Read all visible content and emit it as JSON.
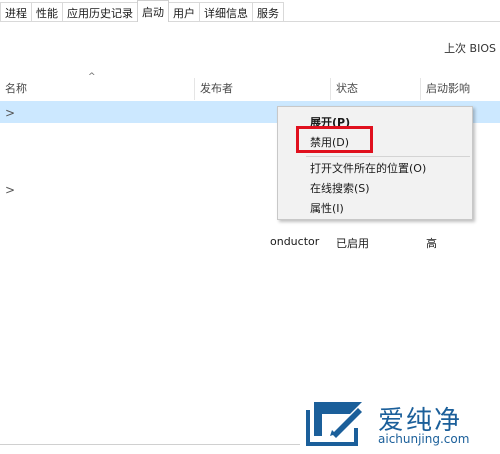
{
  "tabs": [
    {
      "label": "进程"
    },
    {
      "label": "性能"
    },
    {
      "label": "应用历史记录"
    },
    {
      "label": "启动",
      "active": true
    },
    {
      "label": "用户"
    },
    {
      "label": "详细信息"
    },
    {
      "label": "服务"
    }
  ],
  "bios_label": "上次 BIOS",
  "columns": {
    "name": "名称",
    "publisher": "发布者",
    "status": "状态",
    "impact": "启动影响"
  },
  "rows": [
    {
      "publisher_partial": "onductor",
      "status": "已启用",
      "impact": "高"
    }
  ],
  "context_menu": {
    "expand": "展开(P)",
    "disable": "禁用(D)",
    "open_location": "打开文件所在的位置(O)",
    "search_online": "在线搜索(S)",
    "properties": "属性(I)"
  },
  "watermark": {
    "brand": "爱纯净",
    "url": "aichunjing.com"
  },
  "colors": {
    "selection": "#cce8ff",
    "highlight_box": "#e0101e",
    "watermark": "#1b5f9a"
  }
}
